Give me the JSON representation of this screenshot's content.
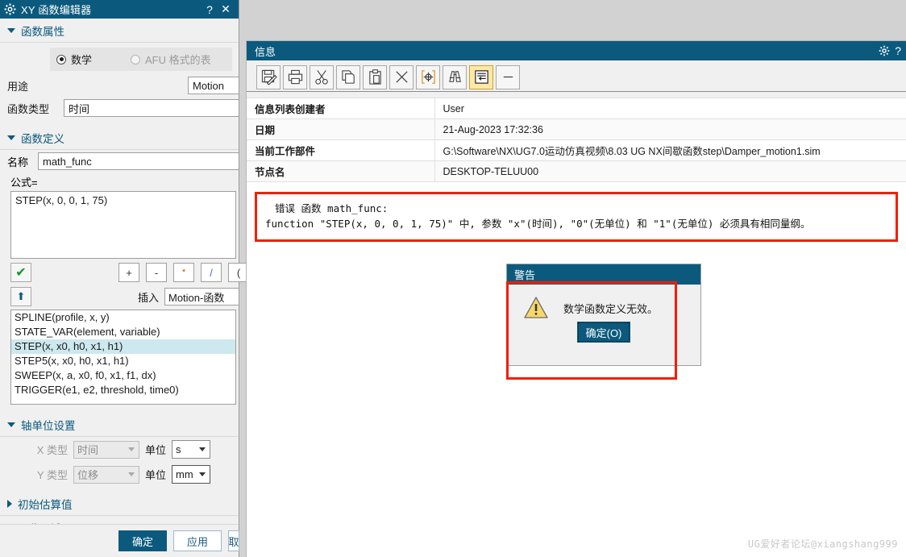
{
  "xy_editor": {
    "title": "XY 函数编辑器",
    "gear_icon": "gear-icon",
    "help_label": "?",
    "close_label": "✕",
    "sections": {
      "func_props": "函数属性",
      "func_def": "函数定义",
      "axis_units": "轴单位设置",
      "initial_estimate": "初始估算值",
      "preview_area": "预览区域"
    },
    "radios": {
      "math": "数学",
      "afu": "AFU 格式的表"
    },
    "fields": {
      "purpose_label": "用途",
      "purpose_value": "Motion",
      "func_type_label": "函数类型",
      "func_type_value": "时间",
      "name_label": "名称",
      "name_value": "math_func",
      "formula_label": "公式=",
      "formula_value": "STEP(x, 0, 0, 1, 75)"
    },
    "operators": [
      "+",
      "-",
      "*",
      "/",
      "("
    ],
    "check_button": "✔",
    "up_button": "⬆",
    "insert_label": "插入",
    "insert_value": "Motion-函数",
    "function_list": [
      "SPLINE(profile, x, y)",
      "STATE_VAR(element, variable)",
      "STEP(x, x0, h0, x1, h1)",
      "STEP5(x, x0, h0, x1, h1)",
      "SWEEP(x, a, x0, f0, x1, f1, dx)",
      "TRIGGER(e1, e2, threshold, time0)"
    ],
    "function_list_selected_index": 2,
    "axis": {
      "x_type_label": "X 类型",
      "x_type_value": "时间",
      "x_unit_label": "单位",
      "x_unit_value": "s",
      "y_type_label": "Y 类型",
      "y_type_value": "位移",
      "y_unit_label": "单位",
      "y_unit_value": "mm"
    },
    "footer": {
      "ok": "确定",
      "apply": "应用",
      "cancel": "取"
    }
  },
  "info_window": {
    "title": "信息",
    "gear_icon": "gear-icon",
    "help_label": "?",
    "toolbar": [
      {
        "name": "save-as-icon",
        "active": false
      },
      {
        "name": "print-icon",
        "active": false
      },
      {
        "name": "cut-icon",
        "active": false
      },
      {
        "name": "copy-icon",
        "active": false
      },
      {
        "name": "paste-icon",
        "active": false
      },
      {
        "name": "delete-icon",
        "active": false
      },
      {
        "name": "select-target-icon",
        "active": false
      },
      {
        "name": "find-binoculars-icon",
        "active": false
      },
      {
        "name": "word-wrap-icon",
        "active": true
      },
      {
        "name": "minimize-icon",
        "active": false
      }
    ],
    "meta_rows": [
      {
        "key": "信息列表创建者",
        "value": "User"
      },
      {
        "key": "日期",
        "value": "21-Aug-2023 17:32:36"
      },
      {
        "key": "当前工作部件",
        "value": "G:\\Software\\NX\\UG7.0运动仿真视频\\8.03 UG NX间歇函数step\\Damper_motion1.sim"
      },
      {
        "key": "节点名",
        "value": "DESKTOP-TELUU00"
      }
    ],
    "error_message": {
      "line1": "错误 函数 math_func:",
      "line2": "function \"STEP(x, 0, 0, 1, 75)\" 中, 参数 \"x\"(时间), \"0\"(无单位) 和 \"1\"(无单位) 必须具有相同量纲。",
      "highlight_color": "#f81c00"
    }
  },
  "warning_dialog": {
    "title": "警告",
    "icon": "warning-triangle-icon",
    "message": "数学函数定义无效。",
    "ok_button": "确定(O)",
    "highlight_color": "#f81c00"
  },
  "watermark": "UG爱好者论坛@xiangshang999",
  "colors": {
    "title_bar": "#0b5a7e",
    "accent": "#0b5a7e",
    "selection": "#cde8ee",
    "warning_yellow": "#fde8a8",
    "error_red": "#f81c00"
  }
}
